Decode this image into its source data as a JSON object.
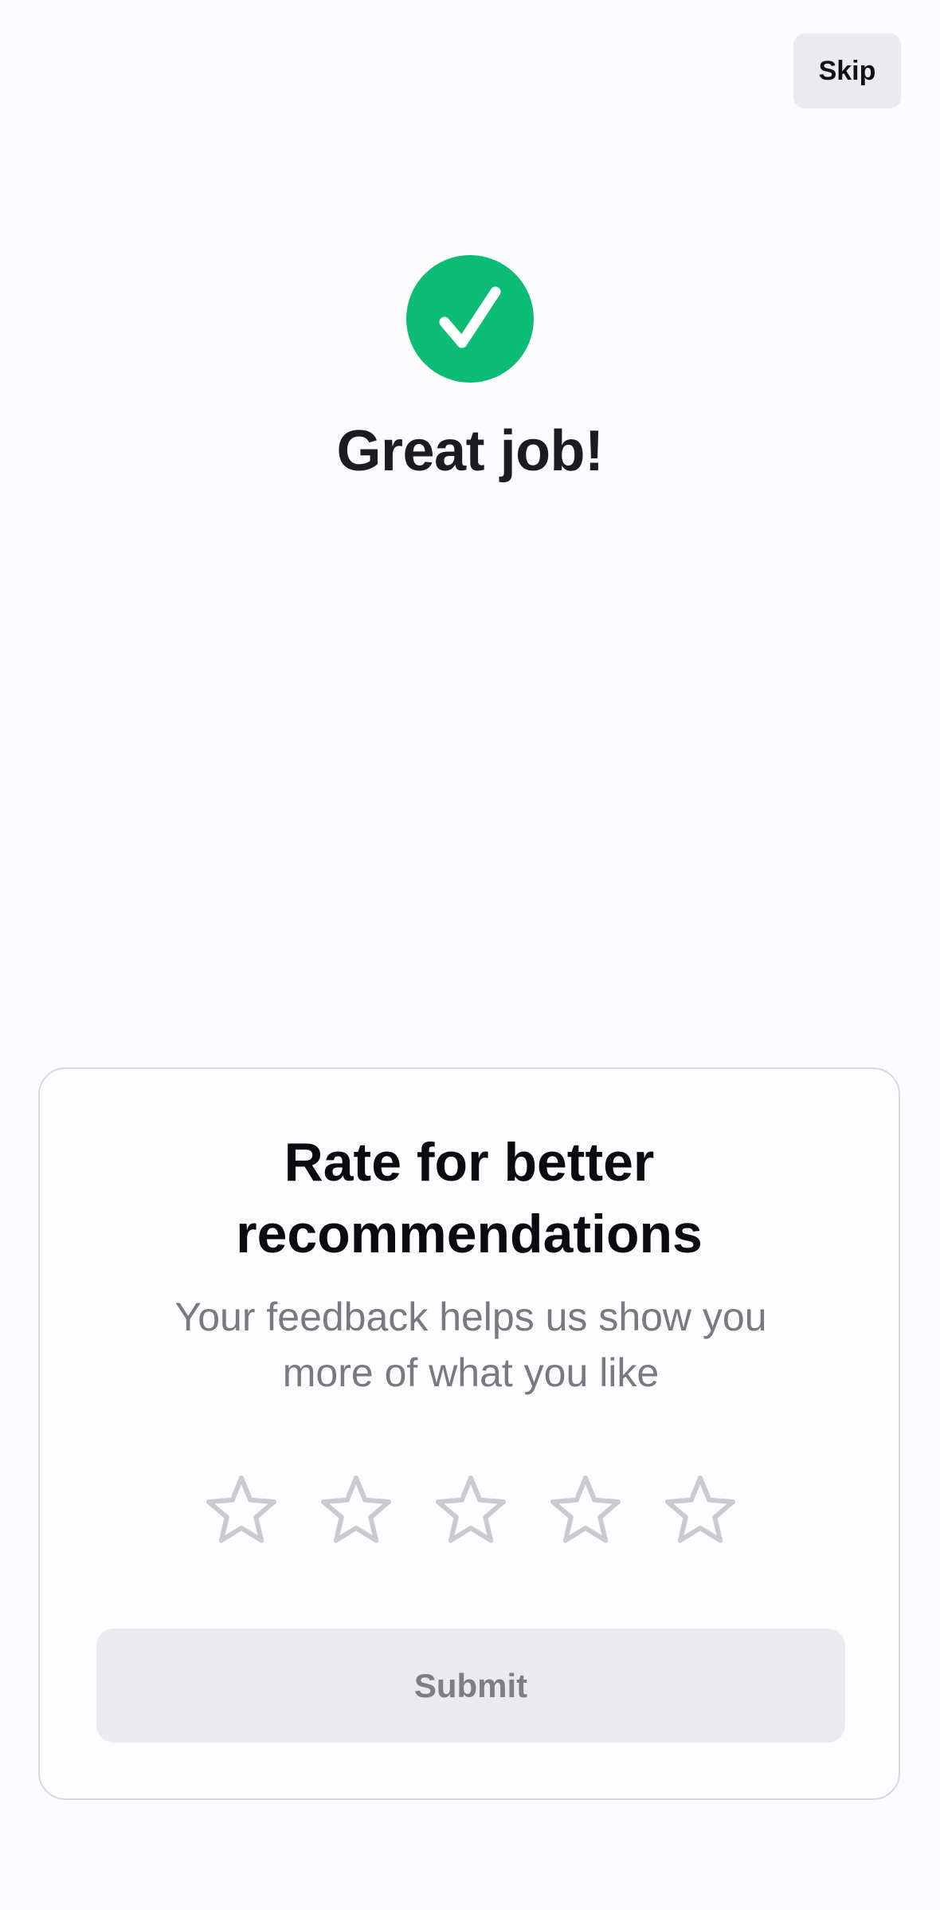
{
  "header": {
    "skip_label": "Skip"
  },
  "success": {
    "icon": "checkmark-icon",
    "title": "Great job!"
  },
  "rating_card": {
    "title_line1": "Rate for better",
    "title_line2": "recommendations",
    "subtitle_line1": "Your feedback helps us show you",
    "subtitle_line2": "more of what you like",
    "stars": [
      {
        "icon": "star-outline-icon",
        "filled": false
      },
      {
        "icon": "star-outline-icon",
        "filled": false
      },
      {
        "icon": "star-outline-icon",
        "filled": false
      },
      {
        "icon": "star-outline-icon",
        "filled": false
      },
      {
        "icon": "star-outline-icon",
        "filled": false
      }
    ],
    "rating_value": 0,
    "rating_max": 5,
    "submit_label": "Submit"
  },
  "colors": {
    "background": "#fcfbfd",
    "success_green": "#0dbc74",
    "button_gray": "#ebeaee",
    "star_outline": "#cbcacf",
    "heading": "#1c1b22",
    "muted_text": "#7a797f"
  }
}
